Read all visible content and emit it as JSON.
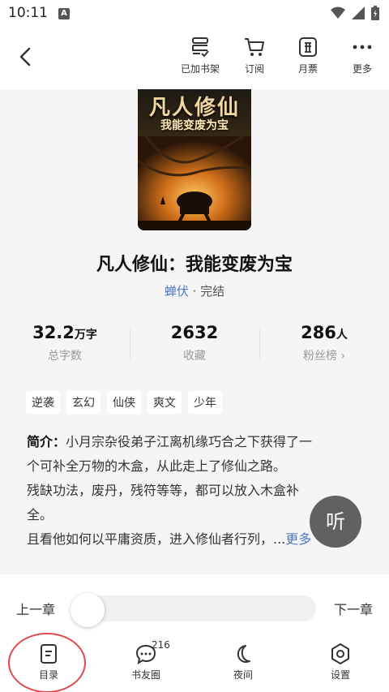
{
  "status": {
    "time": "10:11",
    "notify_glyph": "A"
  },
  "toolbar": {
    "back_icon": "chevron-left-icon",
    "items": [
      {
        "label": "已加书架",
        "icon": "bookshelf-check-icon"
      },
      {
        "label": "订阅",
        "icon": "cart-icon"
      },
      {
        "label": "月票",
        "icon": "ticket-icon"
      },
      {
        "label": "更多",
        "icon": "more-dots-icon"
      }
    ]
  },
  "book": {
    "cover_title": "凡人修仙",
    "cover_subtitle": "我能变废为宝",
    "title": "凡人修仙：我能变废为宝",
    "author": "蝉伏",
    "status": "完结",
    "stats": [
      {
        "value": "32.2",
        "unit": "万字",
        "label": "总字数"
      },
      {
        "value": "2632",
        "unit": "",
        "label": "收藏"
      },
      {
        "value": "286",
        "unit": "人",
        "label": "粉丝榜 ›"
      }
    ],
    "tags": [
      "逆袭",
      "玄幻",
      "仙侠",
      "爽文",
      "少年"
    ],
    "intro_head": "简介：",
    "intro_lines": [
      "小月宗杂役弟子江离机缘巧合之下获得了一",
      "个可补全万物的木盒，从此走上了修仙之路。",
      "残缺功法，废丹，残符等等，都可以放入木盒补",
      "全。",
      "且看他如何以平庸资质，进入修仙者行列，..."
    ],
    "more_label": "更多"
  },
  "listen_label": "听",
  "reader": {
    "prev_chapter": "上一章",
    "next_chapter": "下一章",
    "progress": 0
  },
  "bottom_nav": [
    {
      "label": "目录",
      "icon": "catalog-icon"
    },
    {
      "label": "书友圈",
      "icon": "chat-bubble-icon",
      "badge": "216"
    },
    {
      "label": "夜间",
      "icon": "moon-icon"
    },
    {
      "label": "设置",
      "icon": "settings-icon"
    }
  ],
  "colors": {
    "accent_blue": "#4a78c2",
    "highlight_red": "#e04848",
    "background": "#f5f5f5"
  }
}
